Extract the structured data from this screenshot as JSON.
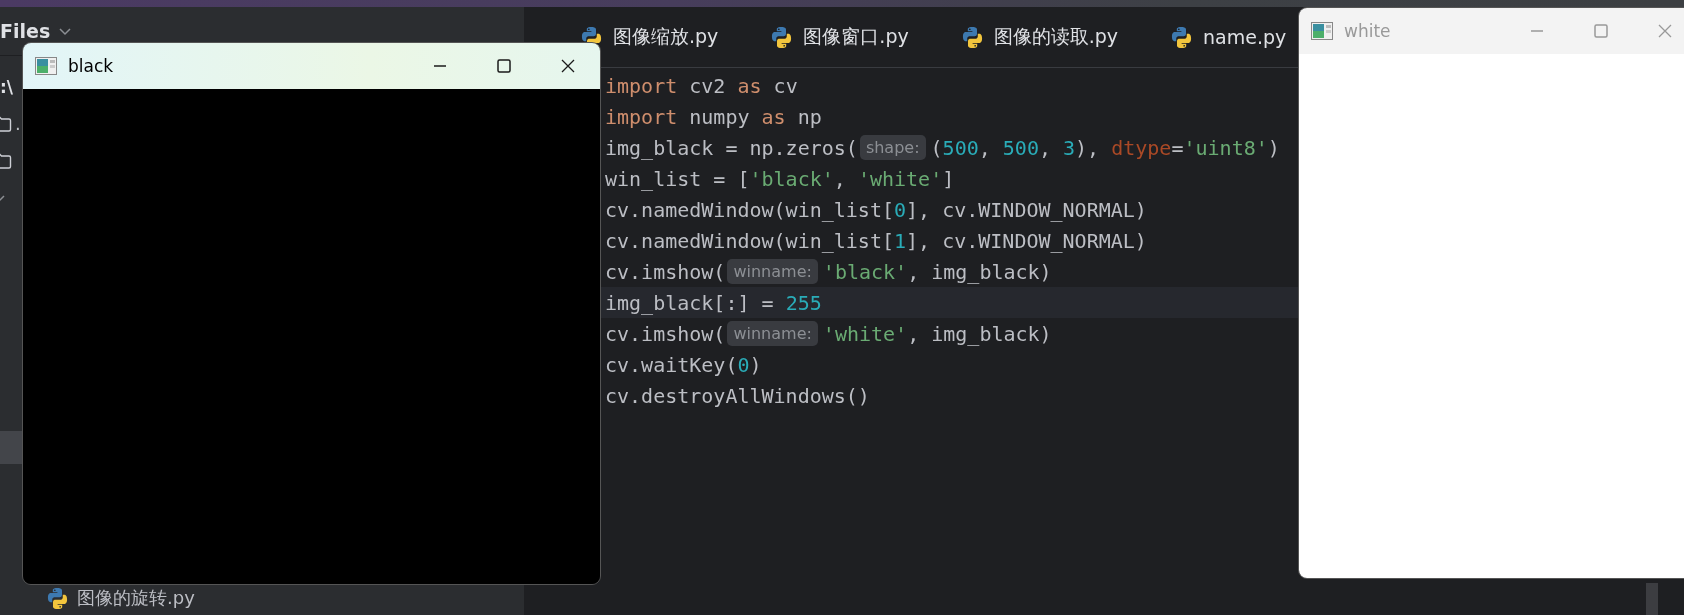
{
  "sidebar": {
    "title": "Files",
    "path": ":\\",
    "items": [
      {
        "kind": "folder",
        "label": "."
      },
      {
        "kind": "folder"
      },
      {
        "kind": "row",
        "expanded": true
      }
    ],
    "selection_visible": true,
    "bottom_file": {
      "label": "图像的旋转.py"
    }
  },
  "editor": {
    "tabs": [
      {
        "label": "图像缩放.py"
      },
      {
        "label": "图像窗口.py"
      },
      {
        "label": "图像的读取.py"
      },
      {
        "label": "name.py"
      }
    ],
    "lines": [
      {
        "current": false,
        "tokens": [
          {
            "kind": "kw",
            "text": "import"
          },
          {
            "kind": "pl",
            "text": " cv2 "
          },
          {
            "kind": "kw",
            "text": "as"
          },
          {
            "kind": "pl",
            "text": " cv"
          }
        ]
      },
      {
        "current": false,
        "tokens": [
          {
            "kind": "kw",
            "text": "import"
          },
          {
            "kind": "pl",
            "text": " numpy "
          },
          {
            "kind": "kw",
            "text": "as"
          },
          {
            "kind": "pl",
            "text": " np"
          }
        ]
      },
      {
        "current": false,
        "tokens": [
          {
            "kind": "pl",
            "text": "img_black = np.zeros("
          },
          {
            "kind": "hint",
            "text": "shape:"
          },
          {
            "kind": "pl",
            "text": "("
          },
          {
            "kind": "num",
            "text": "500"
          },
          {
            "kind": "pl",
            "text": ", "
          },
          {
            "kind": "num",
            "text": "500"
          },
          {
            "kind": "pl",
            "text": ", "
          },
          {
            "kind": "num",
            "text": "3"
          },
          {
            "kind": "pl",
            "text": "), "
          },
          {
            "kind": "param",
            "text": "dtype"
          },
          {
            "kind": "pl",
            "text": "="
          },
          {
            "kind": "str",
            "text": "'uint8'"
          },
          {
            "kind": "pl",
            "text": ")"
          }
        ]
      },
      {
        "current": false,
        "tokens": [
          {
            "kind": "pl",
            "text": "win_list = ["
          },
          {
            "kind": "str",
            "text": "'black'"
          },
          {
            "kind": "pl",
            "text": ", "
          },
          {
            "kind": "str",
            "text": "'white'"
          },
          {
            "kind": "pl",
            "text": "]"
          }
        ]
      },
      {
        "current": false,
        "tokens": [
          {
            "kind": "pl",
            "text": "cv.namedWindow(win_list["
          },
          {
            "kind": "num",
            "text": "0"
          },
          {
            "kind": "pl",
            "text": "], cv.WINDOW_NORMAL)"
          }
        ]
      },
      {
        "current": false,
        "tokens": [
          {
            "kind": "pl",
            "text": "cv.namedWindow(win_list["
          },
          {
            "kind": "num",
            "text": "1"
          },
          {
            "kind": "pl",
            "text": "], cv.WINDOW_NORMAL)"
          }
        ]
      },
      {
        "current": false,
        "tokens": [
          {
            "kind": "pl",
            "text": "cv.imshow("
          },
          {
            "kind": "hint",
            "text": "winname:"
          },
          {
            "kind": "str",
            "text": "'black'"
          },
          {
            "kind": "pl",
            "text": ", img_black)"
          }
        ]
      },
      {
        "current": true,
        "tokens": [
          {
            "kind": "pl",
            "text": "img_black[:] = "
          },
          {
            "kind": "num",
            "text": "255"
          }
        ]
      },
      {
        "current": false,
        "tokens": [
          {
            "kind": "pl",
            "text": "cv.imshow("
          },
          {
            "kind": "hint",
            "text": "winname:"
          },
          {
            "kind": "str",
            "text": "'white'"
          },
          {
            "kind": "pl",
            "text": ", img_black)"
          }
        ]
      },
      {
        "current": false,
        "tokens": [
          {
            "kind": "pl",
            "text": "cv.waitKey("
          },
          {
            "kind": "num",
            "text": "0"
          },
          {
            "kind": "pl",
            "text": ")"
          }
        ]
      },
      {
        "current": false,
        "tokens": [
          {
            "kind": "pl",
            "text": "cv.destroyAllWindows()"
          }
        ]
      }
    ]
  },
  "windows": [
    {
      "title": "black",
      "active": true,
      "color": "#000000"
    },
    {
      "title": "white",
      "active": false,
      "color": "#ffffff"
    }
  ]
}
